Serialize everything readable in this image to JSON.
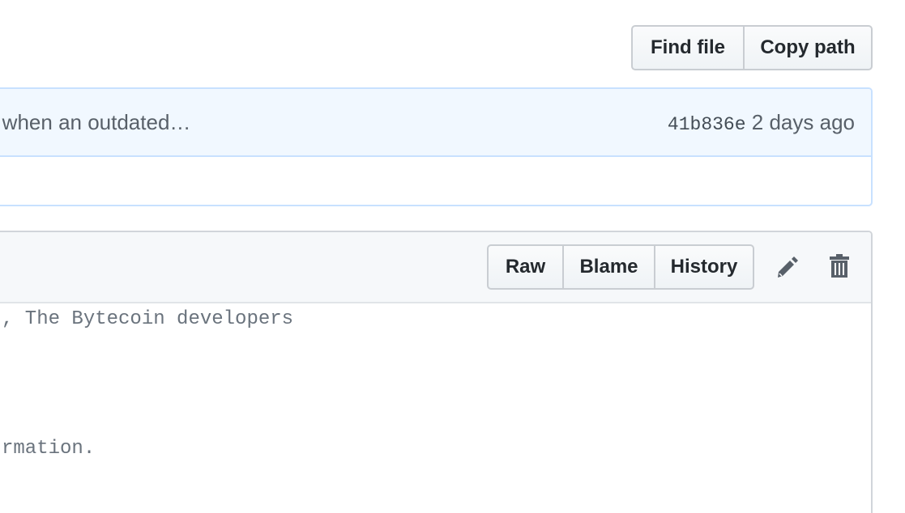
{
  "file_nav": {
    "find_file_label": "Find file",
    "copy_path_label": "Copy path"
  },
  "commit": {
    "message": "us when an outdated…",
    "sha": "41b836e",
    "age": "2 days ago"
  },
  "file_header": {
    "raw_label": "Raw",
    "blame_label": "Blame",
    "history_label": "History",
    "edit_icon": "pencil-icon",
    "delete_icon": "trash-icon"
  },
  "code": {
    "lines": [
      ", The Bytecoin developers",
      "",
      "",
      "",
      "rmation."
    ]
  }
}
